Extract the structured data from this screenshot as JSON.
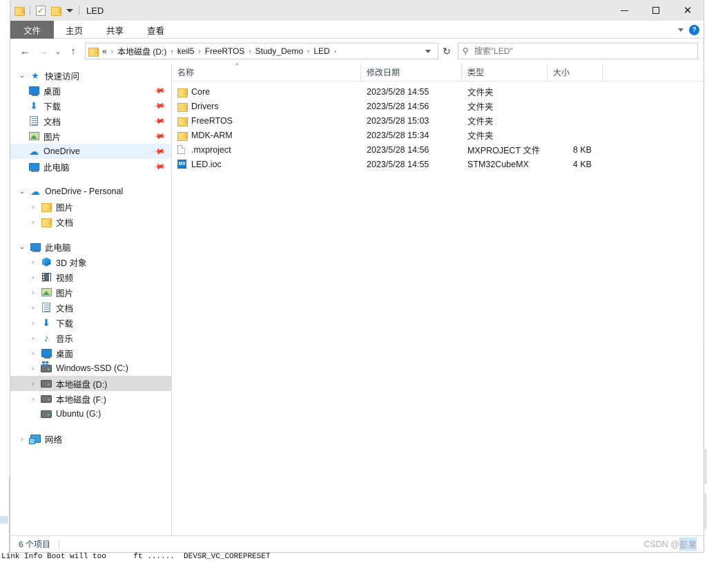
{
  "window": {
    "title": "LED",
    "quick_access_toolbar": [
      {
        "name": "folder-icon",
        "label": "属性"
      },
      {
        "name": "properties-icon",
        "label": "属性"
      },
      {
        "name": "new-folder-icon",
        "label": "新建文件夹"
      },
      {
        "name": "customize-caret-icon",
        "label": "自定义快速访问工具栏"
      }
    ],
    "controls": {
      "minimize": "最小化",
      "maximize": "最大化",
      "close": "关闭"
    }
  },
  "ribbon": {
    "tabs": [
      {
        "label": "文件",
        "active": true
      },
      {
        "label": "主页",
        "active": false
      },
      {
        "label": "共享",
        "active": false
      },
      {
        "label": "查看",
        "active": false
      }
    ],
    "collapse_label": "展开功能区",
    "help_label": "?"
  },
  "navigation": {
    "back": "←",
    "forward": "→",
    "recent": "⌄",
    "up": "↑",
    "refresh": "↻",
    "dropdown": "⌄"
  },
  "address": {
    "prefix": "«",
    "crumbs": [
      "本地磁盘 (D:)",
      "keil5",
      "FreeRTOS",
      "Study_Demo",
      "LED"
    ],
    "separator": "›"
  },
  "search": {
    "placeholder": "搜索\"LED\"",
    "value": "",
    "icon": "search-icon"
  },
  "sidebar": {
    "groups": [
      {
        "name": "快速访问",
        "icon": "star-pin-icon",
        "expanded": true,
        "state": "normal",
        "items": [
          {
            "label": "桌面",
            "icon": "desktop-icon",
            "pinned": true,
            "state": "normal"
          },
          {
            "label": "下载",
            "icon": "downloads-icon",
            "pinned": true,
            "state": "normal"
          },
          {
            "label": "文档",
            "icon": "documents-icon",
            "pinned": true,
            "state": "normal"
          },
          {
            "label": "图片",
            "icon": "pictures-icon",
            "pinned": true,
            "state": "normal"
          },
          {
            "label": "OneDrive",
            "icon": "onedrive-cloud-icon",
            "pinned": true,
            "state": "hover"
          },
          {
            "label": "此电脑",
            "icon": "this-pc-icon",
            "pinned": true,
            "state": "normal"
          }
        ]
      },
      {
        "name": "OneDrive - Personal",
        "icon": "onedrive-cloud-icon",
        "expanded": true,
        "state": "normal",
        "items": [
          {
            "label": "图片",
            "icon": "folder-icon",
            "expandable": true,
            "state": "normal"
          },
          {
            "label": "文档",
            "icon": "folder-icon",
            "expandable": true,
            "state": "normal"
          }
        ]
      },
      {
        "name": "此电脑",
        "icon": "this-pc-icon",
        "expanded": true,
        "state": "normal",
        "items": [
          {
            "label": "3D 对象",
            "icon": "3d-objects-icon",
            "expandable": true,
            "state": "normal"
          },
          {
            "label": "视频",
            "icon": "videos-icon",
            "expandable": true,
            "state": "normal"
          },
          {
            "label": "图片",
            "icon": "pictures-icon",
            "expandable": true,
            "state": "normal"
          },
          {
            "label": "文档",
            "icon": "documents-icon",
            "expandable": true,
            "state": "normal"
          },
          {
            "label": "下载",
            "icon": "downloads-icon",
            "expandable": true,
            "state": "normal"
          },
          {
            "label": "音乐",
            "icon": "music-icon",
            "expandable": true,
            "state": "normal"
          },
          {
            "label": "桌面",
            "icon": "desktop-icon",
            "expandable": true,
            "state": "normal"
          },
          {
            "label": "Windows-SSD (C:)",
            "icon": "windows-drive-icon",
            "expandable": true,
            "state": "normal"
          },
          {
            "label": "本地磁盘 (D:)",
            "icon": "drive-icon",
            "expandable": true,
            "state": "selected"
          },
          {
            "label": "本地磁盘 (F:)",
            "icon": "drive-icon",
            "expandable": true,
            "state": "normal"
          },
          {
            "label": "Ubuntu (G:)",
            "icon": "drive-icon",
            "expandable": false,
            "state": "normal"
          }
        ]
      },
      {
        "name": "网络",
        "icon": "network-icon",
        "expanded": false,
        "state": "normal",
        "items": []
      }
    ]
  },
  "filelist": {
    "columns": [
      {
        "label": "名称",
        "sorted": true,
        "sort_dir": "asc"
      },
      {
        "label": "修改日期",
        "sorted": false
      },
      {
        "label": "类型",
        "sorted": false
      },
      {
        "label": "大小",
        "sorted": false
      }
    ],
    "sort_indicator": "⌃",
    "rows": [
      {
        "name": "Core",
        "icon": "folder-icon",
        "modified": "2023/5/28 14:55",
        "type": "文件夹",
        "size": ""
      },
      {
        "name": "Drivers",
        "icon": "folder-icon",
        "modified": "2023/5/28 14:56",
        "type": "文件夹",
        "size": ""
      },
      {
        "name": "FreeRTOS",
        "icon": "folder-icon",
        "modified": "2023/5/28 15:03",
        "type": "文件夹",
        "size": ""
      },
      {
        "name": "MDK-ARM",
        "icon": "folder-icon",
        "modified": "2023/5/28 15:34",
        "type": "文件夹",
        "size": ""
      },
      {
        "name": ".mxproject",
        "icon": "generic-file-icon",
        "modified": "2023/5/28 14:56",
        "type": "MXPROJECT 文件",
        "size": "8 KB"
      },
      {
        "name": "LED.ioc",
        "icon": "cubemx-file-icon",
        "modified": "2023/5/28 14:55",
        "type": "STM32CubeMX",
        "size": "4 KB"
      }
    ]
  },
  "statusbar": {
    "item_count": "6 个项目"
  },
  "watermark": {
    "prefix": "CSDN @",
    "handle": "彭果"
  },
  "background": {
    "code_line": "Link Info Boot will too      ft ......  DEVSR_VC_COREPRESET"
  },
  "colors": {
    "accent": "#1877c8",
    "folder": "#fcd976",
    "tab_active_bg": "#6b6b6b",
    "selection_gray": "#dcdcdc",
    "hover_blue": "#e8f2fd",
    "header_text": "#3b4a5a"
  }
}
